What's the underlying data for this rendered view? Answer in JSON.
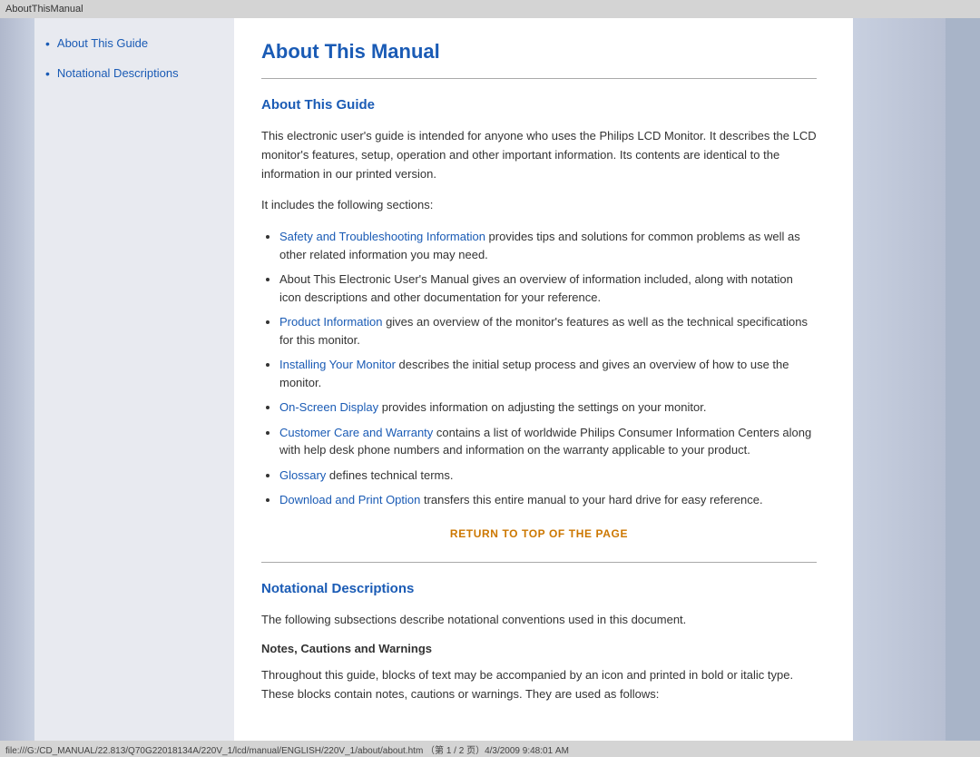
{
  "titleBar": {
    "text": "AboutThisManual"
  },
  "sidebar": {
    "links": [
      {
        "label": "About This Guide",
        "anchor": "about-guide"
      },
      {
        "label": "Notational Descriptions",
        "anchor": "notational"
      }
    ]
  },
  "page": {
    "title": "About This Manual",
    "sections": [
      {
        "id": "about-guide",
        "heading": "About This Guide",
        "paragraphs": [
          "This electronic user's guide is intended for anyone who uses the Philips LCD Monitor. It describes the LCD monitor's features, setup, operation and other important information. Its contents are identical to the information in our printed version.",
          "It includes the following sections:"
        ],
        "listItems": [
          {
            "linkText": "Safety and Troubleshooting Information",
            "rest": " provides tips and solutions for common problems as well as other related information you may need."
          },
          {
            "linkText": null,
            "rest": "About This Electronic User's Manual gives an overview of information included, along with notation icon descriptions and other documentation for your reference."
          },
          {
            "linkText": "Product Information",
            "rest": " gives an overview of the monitor's features as well as the technical specifications for this monitor."
          },
          {
            "linkText": "Installing Your Monitor",
            "rest": " describes the initial setup process and gives an overview of how to use the monitor."
          },
          {
            "linkText": "On-Screen Display",
            "rest": " provides information on adjusting the settings on your monitor."
          },
          {
            "linkText": "Customer Care and Warranty",
            "rest": " contains a list of worldwide Philips Consumer Information Centers along with help desk phone numbers and information on the warranty applicable to your product."
          },
          {
            "linkText": "Glossary",
            "rest": " defines technical terms."
          },
          {
            "linkText": "Download and Print Option",
            "rest": " transfers this entire manual to your hard drive for easy reference."
          }
        ],
        "returnLink": "RETURN TO TOP OF THE PAGE"
      },
      {
        "id": "notational",
        "heading": "Notational Descriptions",
        "paragraphs": [
          "The following subsections describe notational conventions used in this document."
        ],
        "subHeading": "Notes, Cautions and Warnings",
        "subParagraph": "Throughout this guide, blocks of text may be accompanied by an icon and printed in bold or italic type. These blocks contain notes, cautions or warnings. They are used as follows:"
      }
    ]
  },
  "statusBar": {
    "text": "file:///G:/CD_MANUAL/22.813/Q70G22018134A/220V_1/lcd/manual/ENGLISH/220V_1/about/about.htm  （第 1 / 2 页）4/3/2009 9:48:01 AM"
  }
}
